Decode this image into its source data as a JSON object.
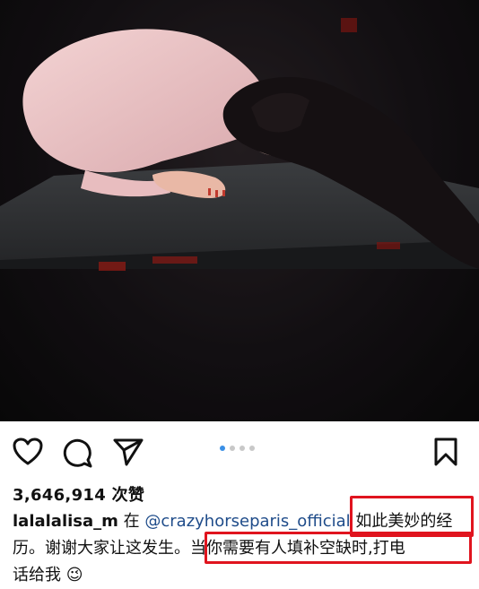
{
  "post": {
    "likes": "3,646,914 次赞",
    "username": "lalalalisa_m",
    "in_word": "在",
    "mention": "@crazyhorseparis_official",
    "caption_part1": "如此美妙的经",
    "caption_line2_a": "历。谢谢大家让这发生。",
    "caption_line2_b": "当你需要有人填补空缺时,打电",
    "caption_line3": "话给我",
    "emoji": "😉"
  },
  "carousel": {
    "total": 4,
    "active": 1
  },
  "icons": {
    "like": "heart-icon",
    "comment": "comment-icon",
    "share": "send-icon",
    "save": "bookmark-icon"
  },
  "colors": {
    "highlight_box": "#e0141e",
    "mention": "#1f4c8a",
    "active_dot": "#3a8fe6"
  }
}
